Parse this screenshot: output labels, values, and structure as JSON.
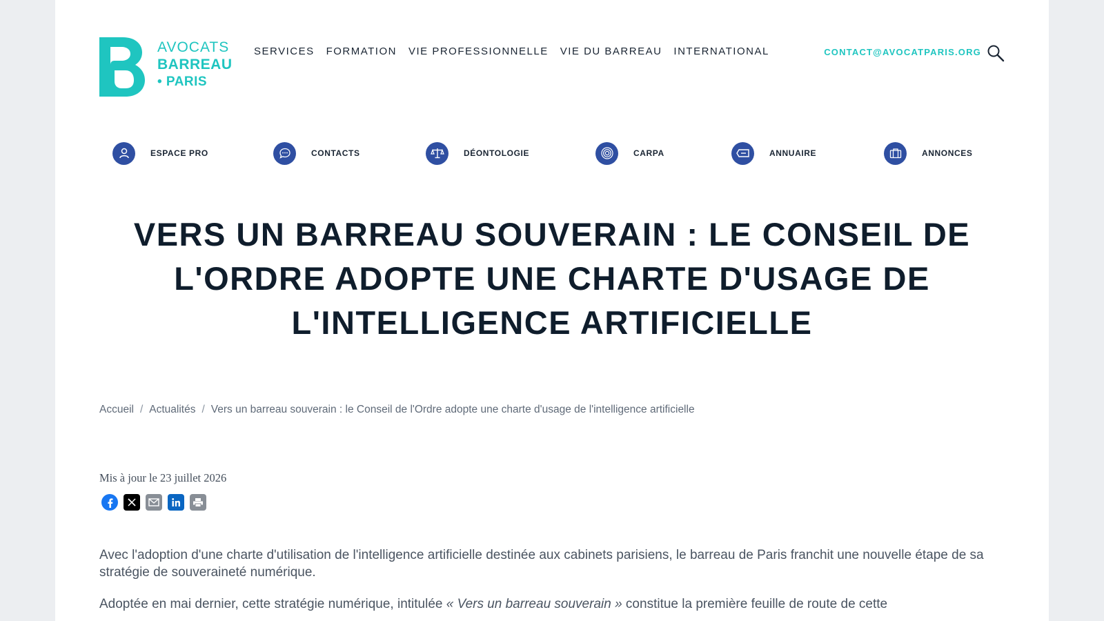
{
  "logo": {
    "line1": "AVOCATS",
    "line2": "BARREAU",
    "line3": "• PARIS"
  },
  "nav": [
    {
      "label": "SERVICES"
    },
    {
      "label": "FORMATION"
    },
    {
      "label": "VIE PROFESSIONNELLE"
    },
    {
      "label": "VIE DU BARREAU"
    },
    {
      "label": "INTERNATIONAL"
    }
  ],
  "contact": "CONTACT@AVOCATPARIS.ORG",
  "quick_links": [
    {
      "label": "ESPACE PRO",
      "icon": "user-icon"
    },
    {
      "label": "CONTACTS",
      "icon": "chat-bubble-icon"
    },
    {
      "label": "DÉONTOLOGIE",
      "icon": "scales-icon"
    },
    {
      "label": "CARPA",
      "icon": "fingerprint-icon"
    },
    {
      "label": "ANNUAIRE",
      "icon": "card-icon"
    },
    {
      "label": "ANNONCES",
      "icon": "briefcase-icon"
    }
  ],
  "title": "VERS UN BARREAU SOUVERAIN : LE CONSEIL DE L'ORDRE ADOPTE UNE CHARTE D'USAGE DE L'INTELLIGENCE ARTIFICIELLE",
  "breadcrumb": {
    "home": "Accueil",
    "section": "Actualités",
    "current": "Vers un barreau souverain : le Conseil de l'Ordre adopte une charte d'usage de l'intelligence artificielle",
    "separator": "/"
  },
  "updated": "Mis à jour le 23 juillet 2026",
  "share": [
    "facebook-icon",
    "x-icon",
    "email-icon",
    "linkedin-icon",
    "print-icon"
  ],
  "body": {
    "p1": "Avec l'adoption d'une charte d'utilisation de l'intelligence artificielle destinée aux cabinets parisiens, le barreau de Paris franchit une nouvelle étape de sa stratégie de souveraineté numérique.",
    "p2_before": "Adoptée en mai dernier, cette stratégie numérique, intitulée ",
    "p2_em": "« Vers un barreau souverain »",
    "p2_after": " constitue la première feuille de route de cette"
  },
  "colors": {
    "brand_teal": "#1fc5c0",
    "icon_blue": "#2f4fa2",
    "title": "#0f1d2c"
  }
}
